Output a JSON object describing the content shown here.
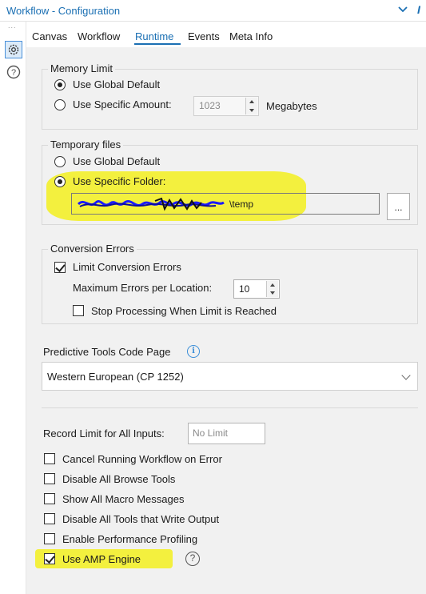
{
  "window": {
    "title": "Workflow - Configuration"
  },
  "sidebar": {
    "dots": "...",
    "icons": [
      "gear-icon",
      "help-icon"
    ]
  },
  "tabs": [
    {
      "label": "Canvas"
    },
    {
      "label": "Workflow"
    },
    {
      "label": "Runtime",
      "active": true
    },
    {
      "label": "Events"
    },
    {
      "label": "Meta Info"
    }
  ],
  "memory_limit": {
    "title": "Memory Limit",
    "use_global_label": "Use Global Default",
    "use_specific_label": "Use Specific Amount:",
    "amount_value": "1023",
    "unit_label": "Megabytes",
    "selected": "use_global"
  },
  "temporary_files": {
    "title": "Temporary files",
    "use_global_label": "Use Global Default",
    "use_specific_label": "Use Specific Folder:",
    "folder_value_visible": "\\temp",
    "browse_label": "...",
    "selected": "use_specific"
  },
  "conversion_errors": {
    "title": "Conversion Errors",
    "limit_label": "Limit Conversion Errors",
    "limit_checked": true,
    "max_errors_label": "Maximum Errors per Location:",
    "max_errors_value": "10",
    "stop_label": "Stop Processing When Limit is Reached",
    "stop_checked": false
  },
  "predictive": {
    "label": "Predictive Tools Code Page",
    "selected_value": "Western European (CP 1252)"
  },
  "record_limit": {
    "label": "Record Limit for All Inputs:",
    "placeholder": "No Limit"
  },
  "options": [
    {
      "label": "Cancel Running Workflow on Error",
      "checked": false
    },
    {
      "label": "Disable All Browse Tools",
      "checked": false
    },
    {
      "label": "Show All Macro Messages",
      "checked": false
    },
    {
      "label": "Disable All Tools that Write Output",
      "checked": false
    },
    {
      "label": "Enable Performance Profiling",
      "checked": false
    },
    {
      "label": "Use AMP Engine",
      "checked": true
    }
  ],
  "colors": {
    "accent": "#1a6fb3",
    "panel_bg": "#f1f1f1",
    "highlight": "#f3f01e",
    "redaction": "#1a1aff"
  }
}
